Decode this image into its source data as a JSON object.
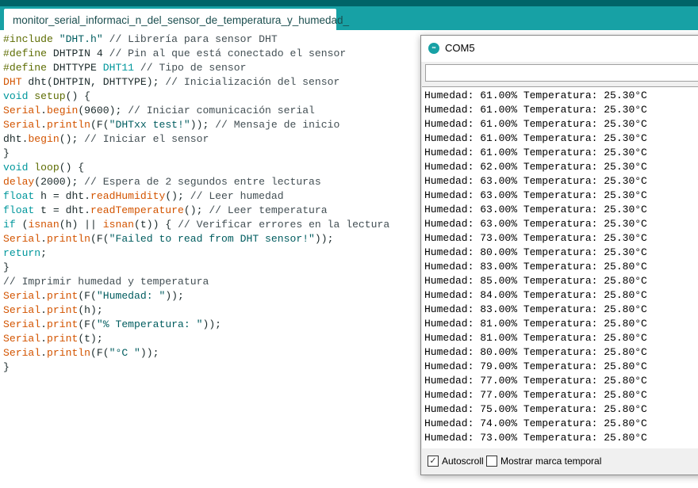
{
  "tab": {
    "label": "monitor_serial_informaci_n_del_sensor_de_temperatura_y_humedad_"
  },
  "code": [
    [
      [
        "pp",
        "#include "
      ],
      [
        "st",
        "\"DHT.h\""
      ],
      [
        "cm",
        " // Librería para sensor DHT"
      ]
    ],
    [
      [
        "pp",
        "#define "
      ],
      [
        "pl",
        "DHTPIN 4 "
      ],
      [
        "cm",
        "// Pin al que está conectado el sensor"
      ]
    ],
    [
      [
        "pp",
        "#define "
      ],
      [
        "pl",
        "DHTTYPE "
      ],
      [
        "kw",
        "DHT11"
      ],
      [
        "cm",
        " // Tipo de sensor"
      ]
    ],
    [
      [
        "fn",
        "DHT"
      ],
      [
        "pl",
        " dht(DHTPIN, DHTTYPE); "
      ],
      [
        "cm",
        "// Inicialización del sensor"
      ]
    ],
    [
      [
        "kw",
        "void "
      ],
      [
        "pp",
        "setup"
      ],
      [
        "pl",
        "() {"
      ]
    ],
    [
      [
        "fn",
        "Serial"
      ],
      [
        "pl",
        "."
      ],
      [
        "fn",
        "begin"
      ],
      [
        "pl",
        "(9600); "
      ],
      [
        "cm",
        "// Iniciar comunicación serial"
      ]
    ],
    [
      [
        "fn",
        "Serial"
      ],
      [
        "pl",
        "."
      ],
      [
        "fn",
        "println"
      ],
      [
        "pl",
        "(F("
      ],
      [
        "st",
        "\"DHTxx test!\""
      ],
      [
        "pl",
        ")); "
      ],
      [
        "cm",
        "// Mensaje de inicio"
      ]
    ],
    [
      [
        "pl",
        "dht."
      ],
      [
        "fn",
        "begin"
      ],
      [
        "pl",
        "(); "
      ],
      [
        "cm",
        "// Iniciar el sensor"
      ]
    ],
    [
      [
        "pl",
        "}"
      ]
    ],
    [
      [
        "kw",
        "void "
      ],
      [
        "pp",
        "loop"
      ],
      [
        "pl",
        "() {"
      ]
    ],
    [
      [
        "fn",
        "delay"
      ],
      [
        "pl",
        "(2000); "
      ],
      [
        "cm",
        "// Espera de 2 segundos entre lecturas"
      ]
    ],
    [
      [
        "kw",
        "float"
      ],
      [
        "pl",
        " h = dht."
      ],
      [
        "fn",
        "readHumidity"
      ],
      [
        "pl",
        "(); "
      ],
      [
        "cm",
        "// Leer humedad"
      ]
    ],
    [
      [
        "kw",
        "float"
      ],
      [
        "pl",
        " t = dht."
      ],
      [
        "fn",
        "readTemperature"
      ],
      [
        "pl",
        "(); "
      ],
      [
        "cm",
        "// Leer temperatura"
      ]
    ],
    [
      [
        "kw",
        "if"
      ],
      [
        "pl",
        " ("
      ],
      [
        "fn",
        "isnan"
      ],
      [
        "pl",
        "(h) || "
      ],
      [
        "fn",
        "isnan"
      ],
      [
        "pl",
        "(t)) { "
      ],
      [
        "cm",
        "// Verificar errores en la lectura"
      ]
    ],
    [
      [
        "fn",
        "Serial"
      ],
      [
        "pl",
        "."
      ],
      [
        "fn",
        "println"
      ],
      [
        "pl",
        "(F("
      ],
      [
        "st",
        "\"Failed to read from DHT sensor!\""
      ],
      [
        "pl",
        "));"
      ]
    ],
    [
      [
        "kw",
        "return"
      ],
      [
        "pl",
        ";"
      ]
    ],
    [
      [
        "pl",
        "}"
      ]
    ],
    [
      [
        "cm",
        "// Imprimir humedad y temperatura"
      ]
    ],
    [
      [
        "fn",
        "Serial"
      ],
      [
        "pl",
        "."
      ],
      [
        "fn",
        "print"
      ],
      [
        "pl",
        "(F("
      ],
      [
        "st",
        "\"Humedad: \""
      ],
      [
        "pl",
        "));"
      ]
    ],
    [
      [
        "fn",
        "Serial"
      ],
      [
        "pl",
        "."
      ],
      [
        "fn",
        "print"
      ],
      [
        "pl",
        "(h);"
      ]
    ],
    [
      [
        "fn",
        "Serial"
      ],
      [
        "pl",
        "."
      ],
      [
        "fn",
        "print"
      ],
      [
        "pl",
        "(F("
      ],
      [
        "st",
        "\"% Temperatura: \""
      ],
      [
        "pl",
        "));"
      ]
    ],
    [
      [
        "fn",
        "Serial"
      ],
      [
        "pl",
        "."
      ],
      [
        "fn",
        "print"
      ],
      [
        "pl",
        "(t);"
      ]
    ],
    [
      [
        "fn",
        "Serial"
      ],
      [
        "pl",
        "."
      ],
      [
        "fn",
        "println"
      ],
      [
        "pl",
        "(F("
      ],
      [
        "st",
        "\"°C \""
      ],
      [
        "pl",
        "));"
      ]
    ],
    [
      [
        "pl",
        "}"
      ]
    ]
  ],
  "serial_monitor": {
    "title": "COM5",
    "input_value": "",
    "output": [
      "Humedad: 61.00% Temperatura: 25.30°C",
      "Humedad: 61.00% Temperatura: 25.30°C",
      "Humedad: 61.00% Temperatura: 25.30°C",
      "Humedad: 61.00% Temperatura: 25.30°C",
      "Humedad: 61.00% Temperatura: 25.30°C",
      "Humedad: 62.00% Temperatura: 25.30°C",
      "Humedad: 63.00% Temperatura: 25.30°C",
      "Humedad: 63.00% Temperatura: 25.30°C",
      "Humedad: 63.00% Temperatura: 25.30°C",
      "Humedad: 63.00% Temperatura: 25.30°C",
      "Humedad: 73.00% Temperatura: 25.30°C",
      "Humedad: 80.00% Temperatura: 25.30°C",
      "Humedad: 83.00% Temperatura: 25.80°C",
      "Humedad: 85.00% Temperatura: 25.80°C",
      "Humedad: 84.00% Temperatura: 25.80°C",
      "Humedad: 83.00% Temperatura: 25.80°C",
      "Humedad: 81.00% Temperatura: 25.80°C",
      "Humedad: 81.00% Temperatura: 25.80°C",
      "Humedad: 80.00% Temperatura: 25.80°C",
      "Humedad: 79.00% Temperatura: 25.80°C",
      "Humedad: 77.00% Temperatura: 25.80°C",
      "Humedad: 77.00% Temperatura: 25.80°C",
      "Humedad: 75.00% Temperatura: 25.80°C",
      "Humedad: 74.00% Temperatura: 25.80°C",
      "Humedad: 73.00% Temperatura: 25.80°C"
    ],
    "autoscroll": {
      "label": "Autoscroll",
      "checked": true
    },
    "timestamp": {
      "label": "Mostrar marca temporal",
      "checked": false
    }
  },
  "colors": {
    "accent": "#17a1a5",
    "header_dark": "#006468",
    "keyword": "#00979c",
    "function": "#d35400"
  }
}
